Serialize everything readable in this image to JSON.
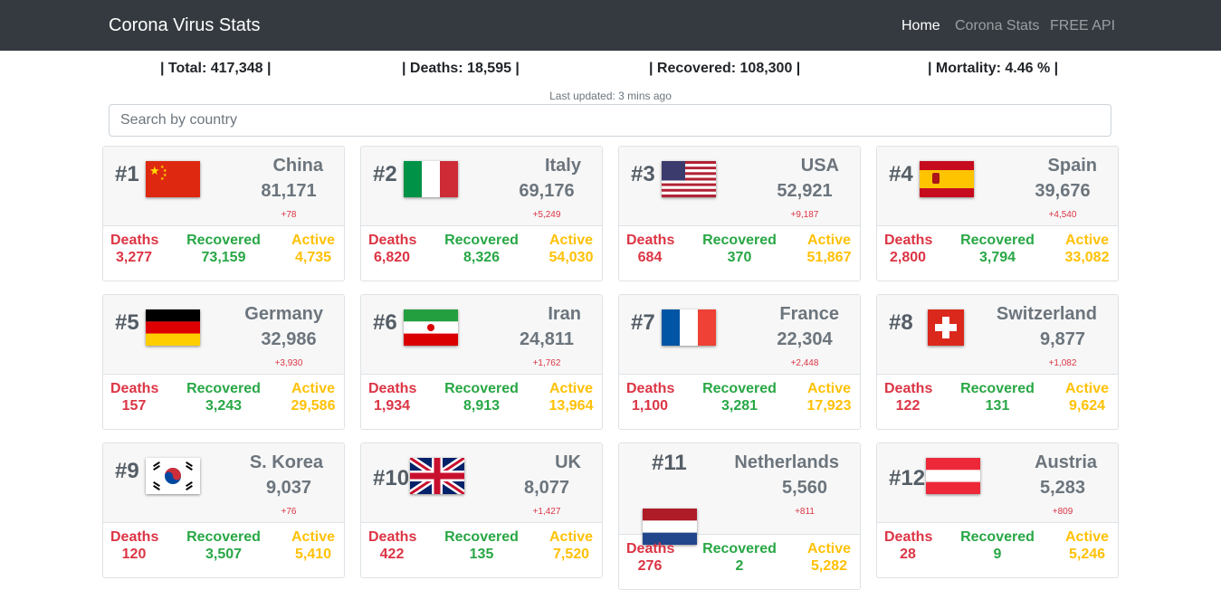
{
  "nav": {
    "brand": "Corona Virus Stats",
    "links": [
      "Home",
      "Corona Stats",
      "FREE API"
    ]
  },
  "stats": {
    "total": "| Total: 417,348 |",
    "deaths": "| Deaths: 18,595 |",
    "recovered": "| Recovered: 108,300 |",
    "mortality": "| Mortality: 4.46 % |"
  },
  "updated": "Last updated: 3 mins ago",
  "search": {
    "placeholder": "Search by country"
  },
  "labels": {
    "deaths": "Deaths",
    "recovered": "Recovered",
    "active": "Active"
  },
  "countries": [
    {
      "rank": "#1",
      "name": "China",
      "total": "81,171",
      "new": "+78",
      "deaths": "3,277",
      "recovered": "73,159",
      "active": "4,735",
      "flag": "china-flag-icon"
    },
    {
      "rank": "#2",
      "name": "Italy",
      "total": "69,176",
      "new": "+5,249",
      "deaths": "6,820",
      "recovered": "8,326",
      "active": "54,030",
      "flag": "italy-flag-icon"
    },
    {
      "rank": "#3",
      "name": "USA",
      "total": "52,921",
      "new": "+9,187",
      "deaths": "684",
      "recovered": "370",
      "active": "51,867",
      "flag": "usa-flag-icon"
    },
    {
      "rank": "#4",
      "name": "Spain",
      "total": "39,676",
      "new": "+4,540",
      "deaths": "2,800",
      "recovered": "3,794",
      "active": "33,082",
      "flag": "spain-flag-icon"
    },
    {
      "rank": "#5",
      "name": "Germany",
      "total": "32,986",
      "new": "+3,930",
      "deaths": "157",
      "recovered": "3,243",
      "active": "29,586",
      "flag": "germany-flag-icon"
    },
    {
      "rank": "#6",
      "name": "Iran",
      "total": "24,811",
      "new": "+1,762",
      "deaths": "1,934",
      "recovered": "8,913",
      "active": "13,964",
      "flag": "iran-flag-icon"
    },
    {
      "rank": "#7",
      "name": "France",
      "total": "22,304",
      "new": "+2,448",
      "deaths": "1,100",
      "recovered": "3,281",
      "active": "17,923",
      "flag": "france-flag-icon"
    },
    {
      "rank": "#8",
      "name": "Switzerland",
      "total": "9,877",
      "new": "+1,082",
      "deaths": "122",
      "recovered": "131",
      "active": "9,624",
      "flag": "switzerland-flag-icon"
    },
    {
      "rank": "#9",
      "name": "S. Korea",
      "total": "9,037",
      "new": "+76",
      "deaths": "120",
      "recovered": "3,507",
      "active": "5,410",
      "flag": "south-korea-flag-icon"
    },
    {
      "rank": "#10",
      "name": "UK",
      "total": "8,077",
      "new": "+1,427",
      "deaths": "422",
      "recovered": "135",
      "active": "7,520",
      "flag": "uk-flag-icon"
    },
    {
      "rank": "#11",
      "name": "Netherlands",
      "total": "5,560",
      "new": "+811",
      "deaths": "276",
      "recovered": "2",
      "active": "5,282",
      "flag": "netherlands-flag-icon"
    },
    {
      "rank": "#12",
      "name": "Austria",
      "total": "5,283",
      "new": "+809",
      "deaths": "28",
      "recovered": "9",
      "active": "5,246",
      "flag": "austria-flag-icon"
    }
  ],
  "colors": {
    "navbar": "#343a40",
    "deaths": "#dc3545",
    "recovered": "#28a745",
    "active": "#ffc107"
  }
}
